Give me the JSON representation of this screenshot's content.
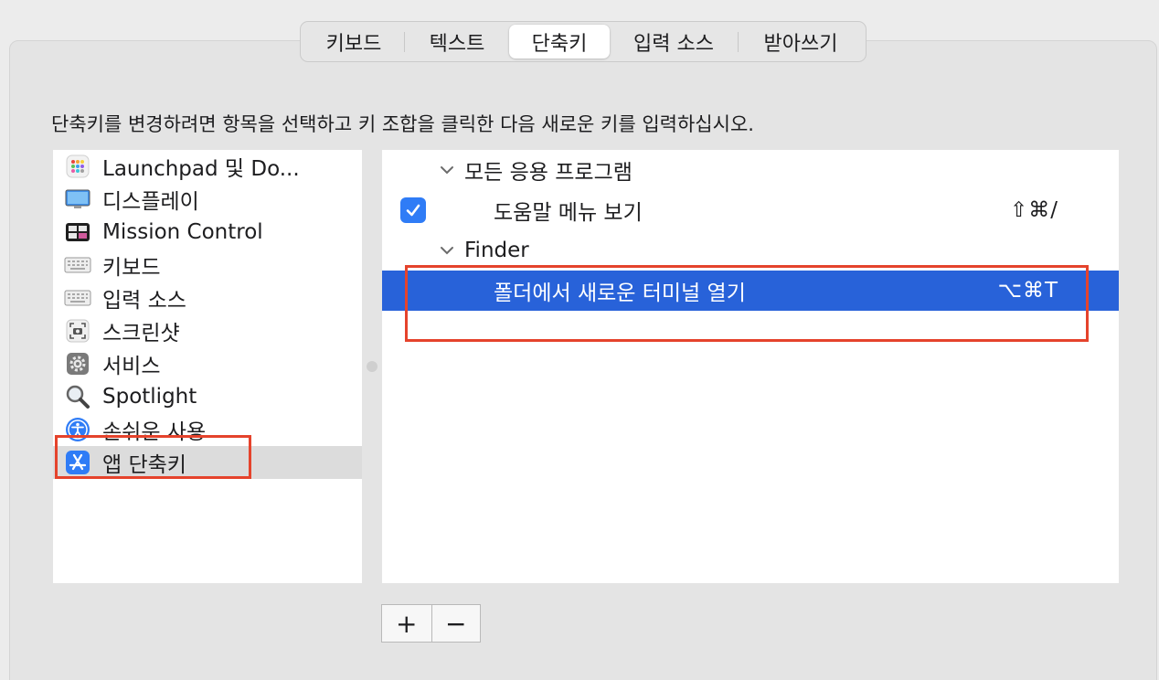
{
  "tabs": [
    {
      "label": "키보드",
      "active": false
    },
    {
      "label": "텍스트",
      "active": false
    },
    {
      "label": "단축키",
      "active": true
    },
    {
      "label": "입력 소스",
      "active": false
    },
    {
      "label": "받아쓰기",
      "active": false
    }
  ],
  "instruction": "단축키를 변경하려면 항목을 선택하고 키 조합을 클릭한 다음 새로운 키를 입력하십시오.",
  "categories": [
    {
      "label": "Launchpad 및 Do...",
      "icon": "launchpad-icon"
    },
    {
      "label": "디스플레이",
      "icon": "display-icon"
    },
    {
      "label": "Mission Control",
      "icon": "mission-control-icon"
    },
    {
      "label": "키보드",
      "icon": "keyboard-icon"
    },
    {
      "label": "입력 소스",
      "icon": "keyboard-icon"
    },
    {
      "label": "스크린샷",
      "icon": "screenshot-icon"
    },
    {
      "label": "서비스",
      "icon": "gear-icon"
    },
    {
      "label": "Spotlight",
      "icon": "magnifier-icon"
    },
    {
      "label": "손쉬운 사용",
      "icon": "accessibility-icon"
    },
    {
      "label": "앱 단축키",
      "icon": "app-store-icon",
      "selected": true
    }
  ],
  "shortcuts": {
    "all_apps_group": "모든 응용 프로그램",
    "help_menu": {
      "label": "도움말 메뉴 보기",
      "keys": "⇧⌘/",
      "checked": true
    },
    "finder_group": "Finder",
    "finder_item": {
      "label": "폴더에서 새로운 터미널 열기",
      "keys": "⌥⌘T",
      "selected": true
    }
  },
  "buttons": {
    "add": "+",
    "remove": "−"
  },
  "colors": {
    "selection": "#2862d9",
    "checkbox": "#2f7cf6",
    "highlight_box": "#e5432c"
  }
}
